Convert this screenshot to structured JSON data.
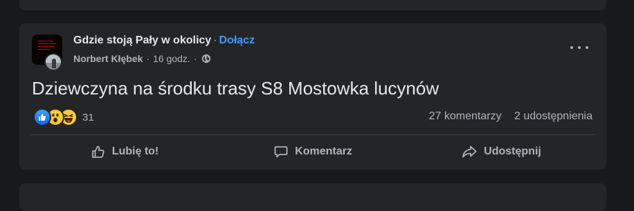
{
  "post": {
    "group_name": "Gdzie stoją Pały w okolicy",
    "separator": "·",
    "join_label": "Dołącz",
    "author": "Norbert Kłębek",
    "time": "16 godz.",
    "text": "Dziewczyna na środku trasy S8 Mostowka lucynów",
    "reaction_count": "31",
    "reaction_icons": [
      "like-icon",
      "wow-icon",
      "haha-icon"
    ],
    "comments": "27 komentarzy",
    "shares": "2 udostępnienia"
  },
  "actions": {
    "like": "Lubię to!",
    "comment": "Komentarz",
    "share": "Udostępnij"
  },
  "colors": {
    "background": "#18191a",
    "card": "#242526",
    "text_primary": "#e4e6eb",
    "text_secondary": "#b0b3b8",
    "link": "#4599ff"
  }
}
